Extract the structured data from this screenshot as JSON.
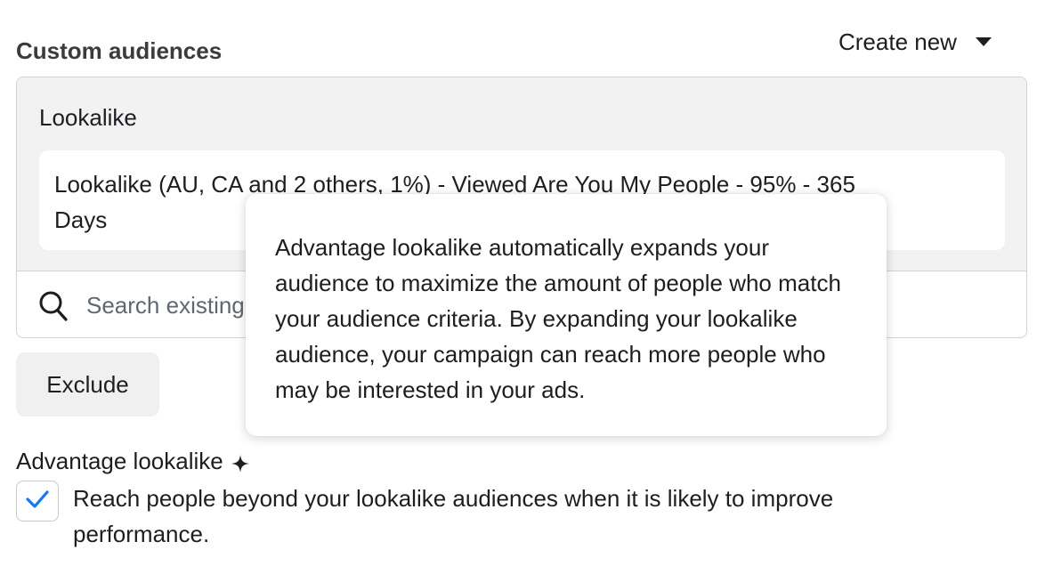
{
  "section": {
    "title": "Custom audiences",
    "create_new_label": "Create new"
  },
  "audience_group": {
    "label": "Lookalike",
    "selected": "Lookalike (AU, CA and 2 others, 1%) - Viewed Are You My People - 95% - 365 Days"
  },
  "search": {
    "placeholder": "Search existing audiences"
  },
  "exclude_label": "Exclude",
  "advantage": {
    "label": "Advantage lookalike",
    "checkbox_checked": true,
    "checkbox_text": "Reach people beyond your lookalike audiences when it is likely to improve performance."
  },
  "tooltip": {
    "text": "Advantage lookalike automatically expands your audience to maximize the amount of people who match your audience criteria. By expanding your lookalike audience, your campaign can reach more people who may be interested in your ads."
  },
  "colors": {
    "accent": "#1877f2",
    "panel_bg": "#f2f2f2",
    "border": "#d0d2d6"
  },
  "icons": [
    "caret-down-icon",
    "search-icon",
    "sparkle-icon",
    "checkmark-icon"
  ]
}
